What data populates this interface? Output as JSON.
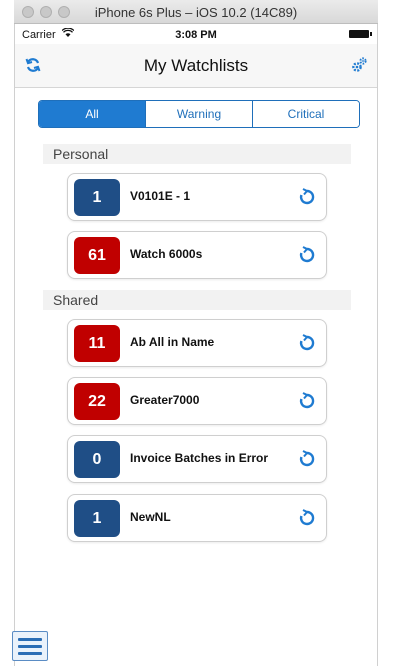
{
  "window": {
    "title": "iPhone 6s Plus – iOS 10.2 (14C89)"
  },
  "statusbar": {
    "carrier": "Carrier",
    "time": "3:08 PM"
  },
  "navbar": {
    "title": "My Watchlists",
    "left_icon": "refresh-icon",
    "right_icon": "gears-icon"
  },
  "filters": [
    {
      "label": "All",
      "active": true
    },
    {
      "label": "Warning",
      "active": false
    },
    {
      "label": "Critical",
      "active": false
    }
  ],
  "sections": [
    {
      "title": "Personal",
      "items": [
        {
          "count": "1",
          "name": "V0101E - 1",
          "color": "#1f4e86"
        },
        {
          "count": "61",
          "name": "Watch 6000s",
          "color": "#c00000"
        }
      ]
    },
    {
      "title": "Shared",
      "items": [
        {
          "count": "11",
          "name": "Ab All in Name",
          "color": "#c00000"
        },
        {
          "count": "22",
          "name": "Greater7000",
          "color": "#c00000"
        },
        {
          "count": "0",
          "name": "Invoice Batches in Error",
          "color": "#1f4e86"
        },
        {
          "count": "1",
          "name": "NewNL",
          "color": "#1f4e86"
        }
      ]
    }
  ],
  "colors": {
    "accent": "#1f7bd1",
    "critical": "#c00000",
    "normal": "#1f4e86"
  }
}
